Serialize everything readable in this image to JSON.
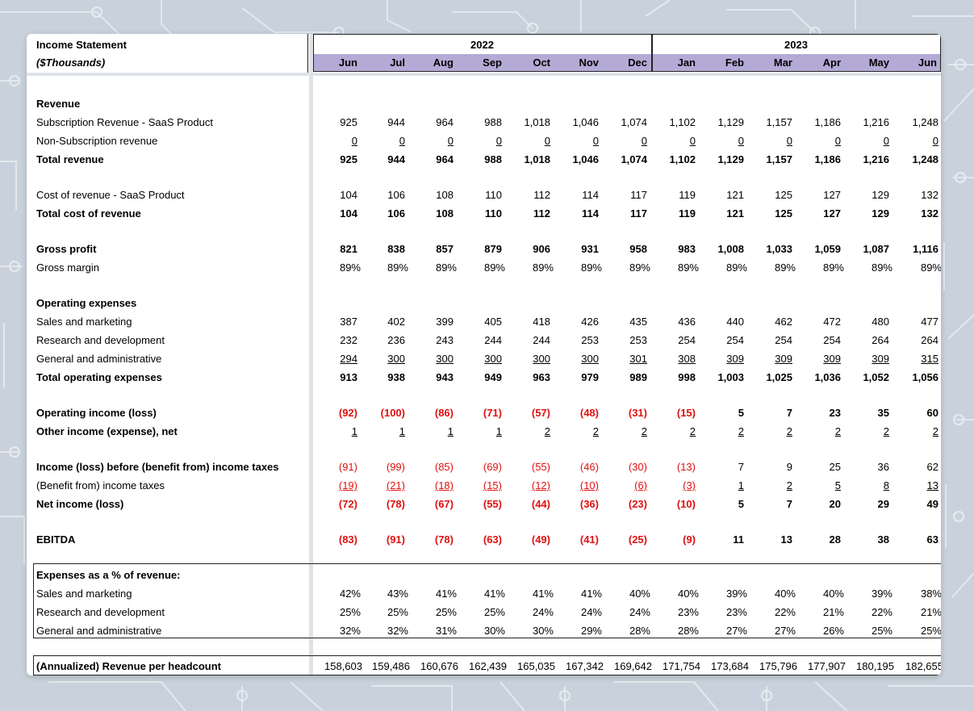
{
  "title": "Income Statement",
  "subtitle": "($Thousands)",
  "years": [
    {
      "label": "2022"
    },
    {
      "label": "2023"
    }
  ],
  "months": [
    "Jun",
    "Jul",
    "Aug",
    "Sep",
    "Oct",
    "Nov",
    "Dec",
    "Jan",
    "Feb",
    "Mar",
    "Apr",
    "May",
    "Jun"
  ],
  "rows": [
    {
      "key": "revenue_hdr",
      "label": "Revenue",
      "style": "bold",
      "values": []
    },
    {
      "key": "sub_rev",
      "label": "Subscription Revenue - SaaS Product",
      "style": "",
      "values": [
        "925",
        "944",
        "964",
        "988",
        "1,018",
        "1,046",
        "1,074",
        "1,102",
        "1,129",
        "1,157",
        "1,186",
        "1,216",
        "1,248"
      ]
    },
    {
      "key": "nonsub_rev",
      "label": "Non-Subscription revenue",
      "style": "ul",
      "values": [
        "0",
        "0",
        "0",
        "0",
        "0",
        "0",
        "0",
        "0",
        "0",
        "0",
        "0",
        "0",
        "0"
      ]
    },
    {
      "key": "total_rev",
      "label": "Total revenue",
      "style": "bold",
      "values": [
        "925",
        "944",
        "964",
        "988",
        "1,018",
        "1,046",
        "1,074",
        "1,102",
        "1,129",
        "1,157",
        "1,186",
        "1,216",
        "1,248"
      ]
    },
    {
      "key": "cost_rev",
      "label": "Cost of revenue - SaaS Product",
      "style": "",
      "values": [
        "104",
        "106",
        "108",
        "110",
        "112",
        "114",
        "117",
        "119",
        "121",
        "125",
        "127",
        "129",
        "132"
      ]
    },
    {
      "key": "total_cost",
      "label": "Total cost of revenue",
      "style": "bold",
      "values": [
        "104",
        "106",
        "108",
        "110",
        "112",
        "114",
        "117",
        "119",
        "121",
        "125",
        "127",
        "129",
        "132"
      ]
    },
    {
      "key": "gross_profit",
      "label": "Gross profit",
      "style": "bold",
      "values": [
        "821",
        "838",
        "857",
        "879",
        "906",
        "931",
        "958",
        "983",
        "1,008",
        "1,033",
        "1,059",
        "1,087",
        "1,116"
      ]
    },
    {
      "key": "gross_margin",
      "label": "Gross margin",
      "style": "pct",
      "values": [
        "89%",
        "89%",
        "89%",
        "89%",
        "89%",
        "89%",
        "89%",
        "89%",
        "89%",
        "89%",
        "89%",
        "89%",
        "89%"
      ]
    },
    {
      "key": "opex_hdr",
      "label": "Operating expenses",
      "style": "bold",
      "values": []
    },
    {
      "key": "sm",
      "label": "Sales and marketing",
      "style": "",
      "values": [
        "387",
        "402",
        "399",
        "405",
        "418",
        "426",
        "435",
        "436",
        "440",
        "462",
        "472",
        "480",
        "477"
      ]
    },
    {
      "key": "rd",
      "label": "Research and development",
      "style": "",
      "values": [
        "232",
        "236",
        "243",
        "244",
        "244",
        "253",
        "253",
        "254",
        "254",
        "254",
        "254",
        "264",
        "264"
      ]
    },
    {
      "key": "ga",
      "label": "General and administrative",
      "style": "ul",
      "values": [
        "294",
        "300",
        "300",
        "300",
        "300",
        "300",
        "301",
        "308",
        "309",
        "309",
        "309",
        "309",
        "315"
      ]
    },
    {
      "key": "total_opex",
      "label": "Total operating expenses",
      "style": "bold",
      "values": [
        "913",
        "938",
        "943",
        "949",
        "963",
        "979",
        "989",
        "998",
        "1,003",
        "1,025",
        "1,036",
        "1,052",
        "1,056"
      ]
    },
    {
      "key": "op_income",
      "label": "Operating income (loss)",
      "style": "bold",
      "values": [
        "(92)",
        "(100)",
        "(86)",
        "(71)",
        "(57)",
        "(48)",
        "(31)",
        "(15)",
        "5",
        "7",
        "23",
        "35",
        "60"
      ]
    },
    {
      "key": "other_income",
      "label": "Other income (expense), net",
      "style": "bold-label-ul",
      "values": [
        "1",
        "1",
        "1",
        "1",
        "2",
        "2",
        "2",
        "2",
        "2",
        "2",
        "2",
        "2",
        "2"
      ]
    },
    {
      "key": "pretax",
      "label": "Income (loss) before (benefit from) income taxes",
      "style": "bold-label",
      "values": [
        "(91)",
        "(99)",
        "(85)",
        "(69)",
        "(55)",
        "(46)",
        "(30)",
        "(13)",
        "7",
        "9",
        "25",
        "36",
        "62"
      ]
    },
    {
      "key": "tax",
      "label": "(Benefit from) income taxes",
      "style": "ul",
      "values": [
        "(19)",
        "(21)",
        "(18)",
        "(15)",
        "(12)",
        "(10)",
        "(6)",
        "(3)",
        "1",
        "2",
        "5",
        "8",
        "13"
      ]
    },
    {
      "key": "net_income",
      "label": "Net income (loss)",
      "style": "bold",
      "values": [
        "(72)",
        "(78)",
        "(67)",
        "(55)",
        "(44)",
        "(36)",
        "(23)",
        "(10)",
        "5",
        "7",
        "20",
        "29",
        "49"
      ]
    },
    {
      "key": "ebitda",
      "label": "EBITDA",
      "style": "bold",
      "values": [
        "(83)",
        "(91)",
        "(78)",
        "(63)",
        "(49)",
        "(41)",
        "(25)",
        "(9)",
        "11",
        "13",
        "28",
        "38",
        "63"
      ]
    },
    {
      "key": "exp_pct_hdr",
      "label": "Expenses as a % of revenue:",
      "style": "bold",
      "values": []
    },
    {
      "key": "sm_pct",
      "label": "Sales and marketing",
      "style": "pct",
      "values": [
        "42%",
        "43%",
        "41%",
        "41%",
        "41%",
        "41%",
        "40%",
        "40%",
        "39%",
        "40%",
        "40%",
        "39%",
        "38%"
      ]
    },
    {
      "key": "rd_pct",
      "label": "Research and development",
      "style": "pct",
      "values": [
        "25%",
        "25%",
        "25%",
        "25%",
        "24%",
        "24%",
        "24%",
        "23%",
        "23%",
        "22%",
        "21%",
        "22%",
        "21%"
      ]
    },
    {
      "key": "ga_pct",
      "label": "General and administrative",
      "style": "pct",
      "values": [
        "32%",
        "32%",
        "31%",
        "30%",
        "30%",
        "29%",
        "28%",
        "28%",
        "27%",
        "27%",
        "26%",
        "25%",
        "25%"
      ]
    },
    {
      "key": "rev_per_head",
      "label": "(Annualized) Revenue per headcount",
      "style": "bold-label",
      "values": [
        "158,603",
        "159,486",
        "160,676",
        "162,439",
        "165,035",
        "167,342",
        "169,642",
        "171,754",
        "173,684",
        "175,796",
        "177,907",
        "180,195",
        "182,655"
      ]
    }
  ],
  "colors": {
    "header_band": "#b4aad6",
    "negative": "#e01010",
    "background": "#c9d2dc"
  }
}
